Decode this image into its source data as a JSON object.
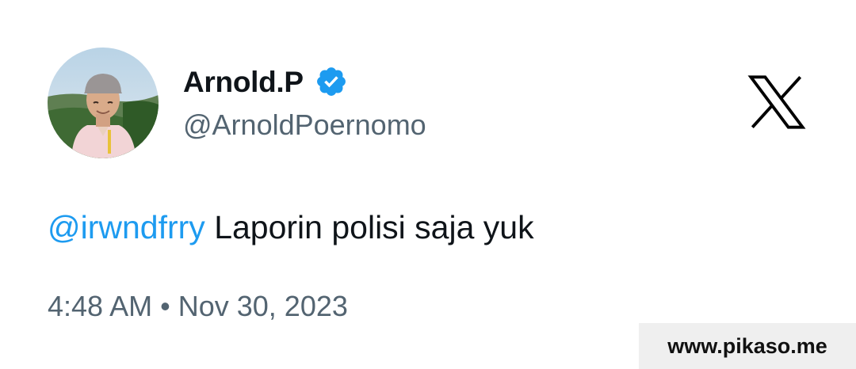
{
  "author": {
    "display_name": "Arnold.P",
    "handle": "@ArnoldPoernomo",
    "verified": true,
    "avatar_icon": "profile-photo"
  },
  "brand": {
    "logo_icon": "x-logo-icon"
  },
  "tweet": {
    "mention": "@irwndfrry",
    "text": " Laporin polisi saja yuk",
    "time": "4:48 AM",
    "separator": "•",
    "date": "Nov 30, 2023"
  },
  "watermark": {
    "text": "www.pikaso.me"
  },
  "colors": {
    "mention": "#1d9bf0",
    "verified_badge": "#1d9bf0",
    "secondary_text": "#536471",
    "primary_text": "#0f1419",
    "background": "#ffffff",
    "watermark_bg": "#efefef"
  }
}
